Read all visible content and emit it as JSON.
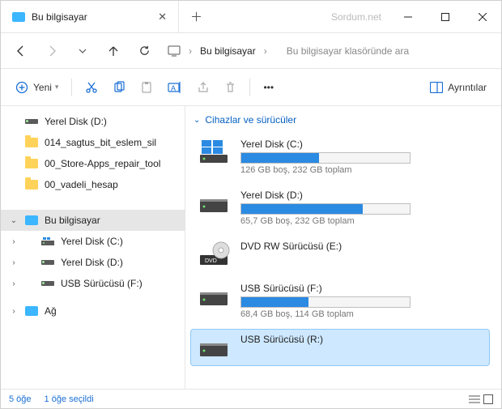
{
  "window": {
    "title": "Bu bilgisayar",
    "watermark": "Sordum.net"
  },
  "breadcrumb": {
    "location": "Bu bilgisayar"
  },
  "search": {
    "placeholder": "Bu bilgisayar klasöründe ara"
  },
  "toolbar": {
    "new_label": "Yeni",
    "details_label": "Ayrıntılar"
  },
  "sidebar": {
    "quick": [
      {
        "label": "Yerel Disk (D:)",
        "icon": "disk"
      },
      {
        "label": "014_sagtus_bit_eslem_sil",
        "icon": "folder"
      },
      {
        "label": "00_Store-Apps_repair_tool",
        "icon": "folder"
      },
      {
        "label": "00_vadeli_hesap",
        "icon": "folder"
      }
    ],
    "this_pc": {
      "label": "Bu bilgisayar",
      "children": [
        {
          "label": "Yerel Disk (C:)"
        },
        {
          "label": "Yerel Disk (D:)"
        },
        {
          "label": "USB Sürücüsü (F:)"
        }
      ]
    },
    "network": {
      "label": "Ağ"
    }
  },
  "main": {
    "section_title": "Cihazlar ve sürücüler",
    "drives": [
      {
        "title": "Yerel Disk (C:)",
        "sub": "126 GB boş, 232 GB toplam",
        "fill": 46,
        "has_bar": true,
        "icon": "win"
      },
      {
        "title": "Yerel Disk (D:)",
        "sub": "65,7 GB boş, 232 GB toplam",
        "fill": 72,
        "has_bar": true,
        "icon": "hdd"
      },
      {
        "title": "DVD RW Sürücüsü (E:)",
        "sub": "",
        "fill": 0,
        "has_bar": false,
        "icon": "dvd"
      },
      {
        "title": "USB Sürücüsü (F:)",
        "sub": "68,4 GB boş, 114 GB toplam",
        "fill": 40,
        "has_bar": true,
        "icon": "hdd"
      },
      {
        "title": "USB Sürücüsü (R:)",
        "sub": "",
        "fill": 0,
        "has_bar": false,
        "icon": "hdd",
        "selected": true
      }
    ]
  },
  "status": {
    "count": "5 öğe",
    "selected": "1 öğe seçildi"
  }
}
